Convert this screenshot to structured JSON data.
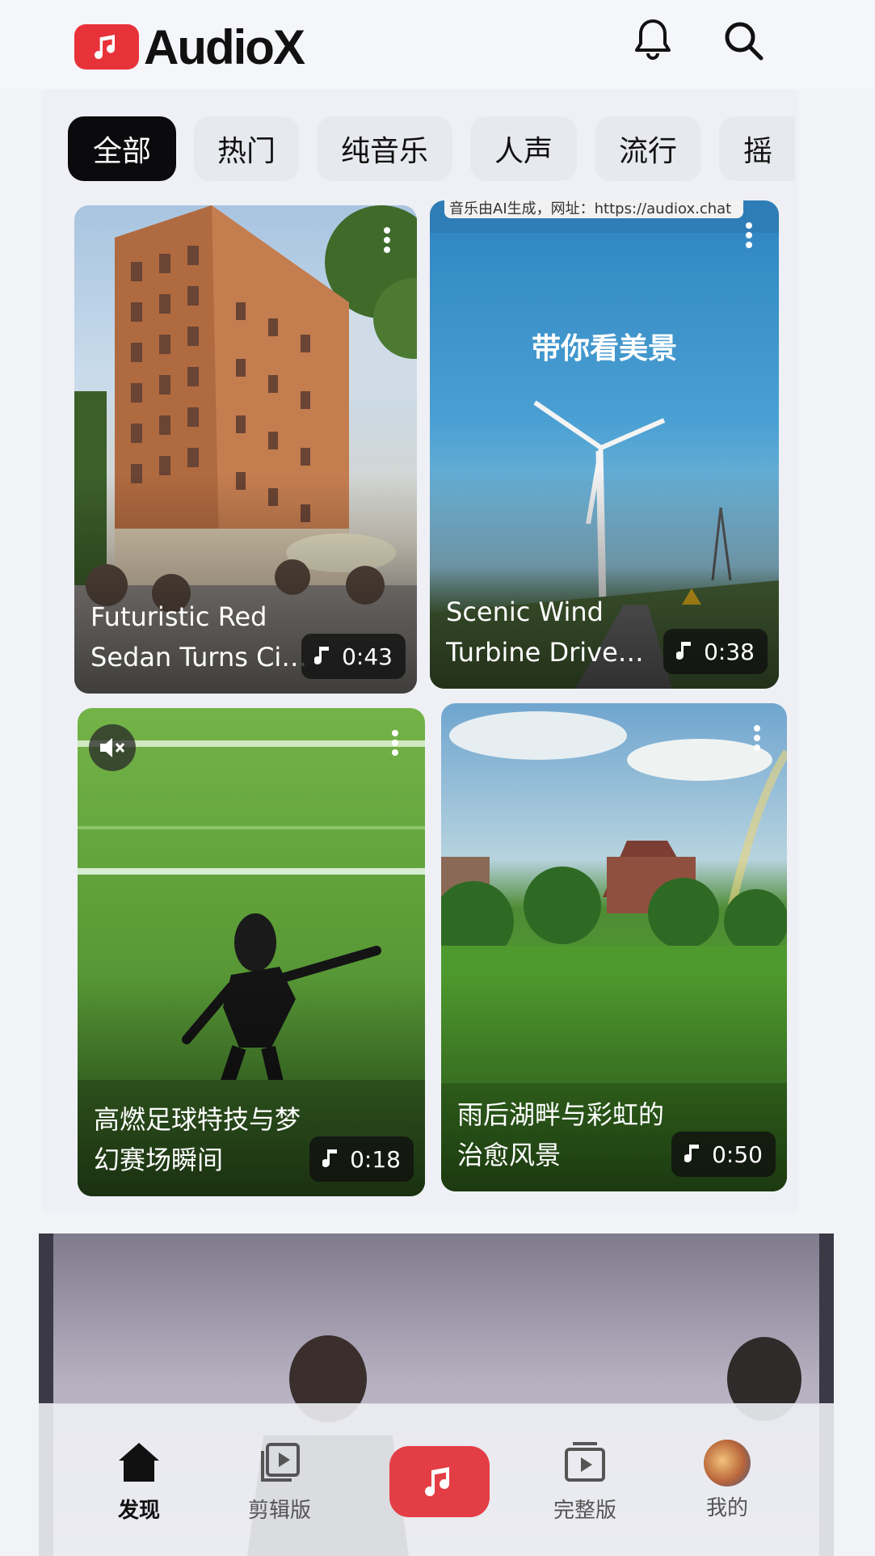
{
  "app": {
    "name": "AudioX"
  },
  "colors": {
    "brand": "#e8323a",
    "active_tab": "#0b0b0d"
  },
  "header": {
    "icons": [
      "bell-icon",
      "search-icon"
    ]
  },
  "tabs": [
    {
      "label": "全部",
      "active": true
    },
    {
      "label": "热门"
    },
    {
      "label": "纯音乐"
    },
    {
      "label": "人声"
    },
    {
      "label": "流行"
    },
    {
      "label": "摇"
    }
  ],
  "cards": [
    {
      "title": "Futuristic Red Sedan Turns Ci…",
      "duration": "0:43"
    },
    {
      "title": "Scenic Wind Turbine Drive T…",
      "duration": "0:38",
      "overlay_text": "带你看美景",
      "watermark": "音乐由AI生成，网址：https://audiox.chat"
    },
    {
      "title": "高燃足球特技与梦幻赛场瞬间",
      "duration": "0:18"
    },
    {
      "title": "雨后湖畔与彩虹的治愈风景",
      "duration": "0:50"
    }
  ],
  "bottom_nav": [
    {
      "label": "发现",
      "icon": "home-icon",
      "active": true
    },
    {
      "label": "剪辑版",
      "icon": "clip-library-icon"
    },
    {
      "label": "",
      "icon": "music-note-icon"
    },
    {
      "label": "完整版",
      "icon": "full-video-icon"
    },
    {
      "label": "我的",
      "icon": "avatar"
    }
  ]
}
